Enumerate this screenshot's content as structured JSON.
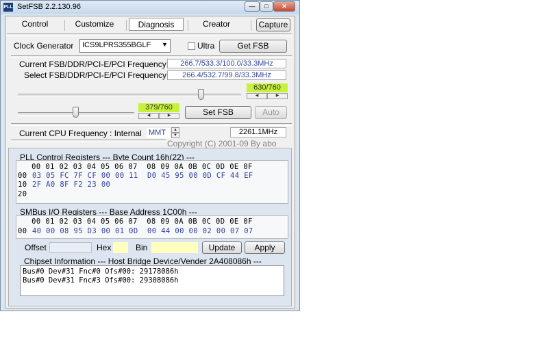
{
  "window": {
    "title": "SetFSB 2.2.130.96",
    "icon": "app-icon"
  },
  "tabs": [
    {
      "label": "Control"
    },
    {
      "label": "Customize"
    },
    {
      "label": "Diagnosis",
      "active": true
    },
    {
      "label": "Creator"
    }
  ],
  "capture_label": "Capture",
  "clock": {
    "label": "Clock Generator",
    "selected": "ICS9LPRS355BGLF",
    "ultra_label": "Ultra",
    "ultra_checked": false,
    "get_fsb_label": "Get FSB"
  },
  "freq": {
    "current_label": "Current FSB/DDR/PCI-E/PCI Frequency",
    "current_value": "266.7/533.3/100.0/33.3MHz",
    "select_label": "Select FSB/DDR/PCI-E/PCI Frequency",
    "select_value": "266.4/532.7/99.8/33.3MHz"
  },
  "slider1": {
    "value": 630,
    "max": 760,
    "readout": "630/760"
  },
  "slider2": {
    "value": 379,
    "max": 760,
    "readout": "379/760"
  },
  "set_fsb_label": "Set FSB",
  "auto_label": "Auto",
  "cpu": {
    "label": "Current CPU Frequency : Internal",
    "mode": "MMT",
    "value": "2261.1MHz"
  },
  "copyright": "Copyright (C) 2001-09 By abo",
  "pll": {
    "header": "PLL Control Registers  --- Byte Count 16h(22) ---",
    "columns": "   00 01 02 03 04 05 06 07  08 09 0A 0B 0C 0D 0E 0F",
    "rows": [
      {
        "addr": "00",
        "bytes": "03 05 FC 7F CF 00 00 11  D0 45 95 00 0D CF 44 EF"
      },
      {
        "addr": "10",
        "bytes": "2F A0 8F F2 23 00"
      },
      {
        "addr": "20",
        "bytes": ""
      }
    ]
  },
  "smbus": {
    "header": "SMBus I/O Registers  --- Base Address 1C00h ---",
    "columns": "   00 01 02 03 04 05 06 07  08 09 0A 0B 0C 0D 0E 0F",
    "rows": [
      {
        "addr": "00",
        "bytes": "40 00 08 95 D3 00 01 0D  00 44 00 00 02 00 07 07"
      }
    ]
  },
  "io": {
    "offset_label": "Offset",
    "offset_value": "",
    "hex_label": "Hex",
    "hex_value": "",
    "bin_label": "Bin",
    "bin_value": "",
    "update_label": "Update",
    "apply_label": "Apply"
  },
  "chipset": {
    "header": "Chipset Information  --- Host Bridge Device/Vender 2A408086h ---",
    "lines": [
      "Bus#0 Dev#31 Fnc#0 Ofs#00: 29178086h",
      "Bus#0 Dev#31 Fnc#3 Ofs#00: 29308086h"
    ]
  },
  "colors": {
    "lime": "#c8f23a",
    "value_text": "#2e3fa0",
    "close": "#c44a31"
  }
}
